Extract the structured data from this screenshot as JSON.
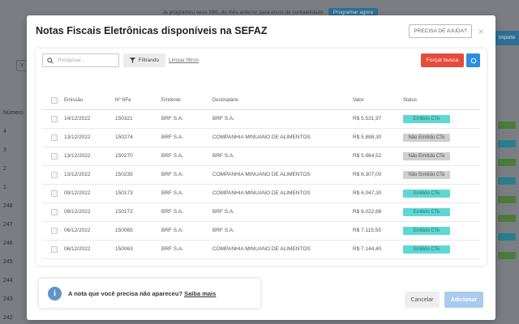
{
  "background": {
    "banner_text": "Já programou seus XML do mês anterior para envio de contabilidade",
    "banner_button": "Programar agora",
    "top_right_button": "Importe",
    "column_header": "Número",
    "rows": [
      "4",
      "3",
      "2",
      "1",
      "248",
      "247",
      "246",
      "245",
      "244",
      "243",
      "242"
    ]
  },
  "modal": {
    "title": "Notas Fiscais Eletrônicas disponíveis na SEFAZ",
    "help_label": "PRECISA DE AJUDA?",
    "close_label": "×"
  },
  "toolbar": {
    "search_placeholder": "Pesquisar...",
    "filter_label": "Filtrando",
    "clear_filters": "Limpar filtros",
    "force_label": "Forçar busca"
  },
  "table": {
    "headers": {
      "date": "Emissão",
      "number": "Nº NFe",
      "issuer": "Emitente",
      "recipient": "Destinatário",
      "value": "Valor",
      "status": "Status"
    },
    "rows": [
      {
        "date": "14/12/2022",
        "number": "150321",
        "issuer": "BRF S.A.",
        "recipient": "BRF S.A.",
        "value": "R$ 5.531,97",
        "status": "Emitido CTe",
        "emitted": true
      },
      {
        "date": "13/12/2022",
        "number": "150274",
        "issuer": "BRF S.A.",
        "recipient": "COMPANHIA MINUANO DE ALIMENTOS",
        "value": "R$ 5.888,30",
        "status": "Não Emitido CTe",
        "emitted": false
      },
      {
        "date": "13/12/2022",
        "number": "150270",
        "issuer": "BRF S.A.",
        "recipient": "BRF S.A.",
        "value": "R$ 5.864,52",
        "status": "Não Emitido CTe",
        "emitted": false
      },
      {
        "date": "13/12/2022",
        "number": "150235",
        "issuer": "BRF S.A.",
        "recipient": "COMPANHIA MINUANO DE ALIMENTOS",
        "value": "R$ 6.307,00",
        "status": "Não Emitido CTe",
        "emitted": false
      },
      {
        "date": "09/12/2022",
        "number": "150173",
        "issuer": "BRF S.A.",
        "recipient": "COMPANHIA MINUANO DE ALIMENTOS",
        "value": "R$ 6.047,30",
        "status": "Emitido CTe",
        "emitted": true
      },
      {
        "date": "09/12/2022",
        "number": "150172",
        "issuer": "BRF S.A.",
        "recipient": "BRF S.A.",
        "value": "R$ 6.022,88",
        "status": "Emitido CTe",
        "emitted": true
      },
      {
        "date": "06/12/2022",
        "number": "150065",
        "issuer": "BRF S.A.",
        "recipient": "BRF S.A.",
        "value": "R$ 7.115,55",
        "status": "Emitido CTe",
        "emitted": true
      },
      {
        "date": "06/12/2022",
        "number": "150063",
        "issuer": "BRF S.A.",
        "recipient": "COMPANHIA MINUANO DE ALIMENTOS",
        "value": "R$ 7.144,40",
        "status": "Emitido CTe",
        "emitted": true
      }
    ]
  },
  "info": {
    "icon": "info-icon",
    "text": "A nota que você precisa não apareceu?",
    "link": "Saiba mais"
  },
  "footer": {
    "cancel_label": "Cancelar",
    "add_label": "Adicionar"
  },
  "colors": {
    "emitted_badge": "#5ed8d3",
    "not_emitted_badge": "#cfcfcf",
    "force_button": "#e74b3c",
    "refresh_button": "#2d8de0",
    "add_button": "#a9cbee"
  }
}
